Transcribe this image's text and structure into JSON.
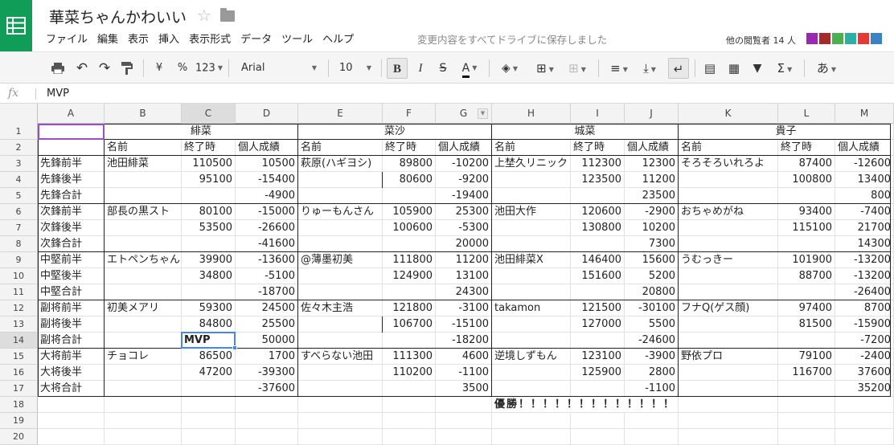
{
  "header": {
    "title": "華菜ちゃんかわいい",
    "menus": [
      "ファイル",
      "編集",
      "表示",
      "挿入",
      "表示形式",
      "データ",
      "ツール",
      "ヘルプ"
    ],
    "save_status": "変更内容をすべてドライブに保存しました",
    "viewers_label": "他の閲覧者 14 人",
    "viewer_colors": [
      "#9c27b0",
      "#a52a2a",
      "#4caf50",
      "#2db0a3",
      "#e53935",
      "#3b82c4"
    ]
  },
  "toolbar": {
    "currency": "¥",
    "percent": "%",
    "number_format": "123",
    "font": "Arial",
    "font_size": "10",
    "bold": "B",
    "italic": "I",
    "strike": "S",
    "text_color": "A",
    "input_tools": "あ",
    "sigma": "Σ"
  },
  "formula_bar": {
    "fx": "fx",
    "value": "MVP"
  },
  "grid": {
    "columns": [
      "A",
      "B",
      "C",
      "D",
      "E",
      "F",
      "G",
      "H",
      "I",
      "J",
      "K",
      "L",
      "M"
    ],
    "selected_column": "C",
    "filter_column": "G",
    "rows": [
      "1",
      "2",
      "3",
      "4",
      "5",
      "6",
      "7",
      "8",
      "9",
      "10",
      "11",
      "12",
      "13",
      "14",
      "15",
      "16",
      "17",
      "18",
      "19",
      "20"
    ],
    "selected_row": "14",
    "group_headers": [
      "緋菜",
      "菜沙",
      "城菜",
      "貴子"
    ],
    "subheaders": [
      "名前",
      "終了時",
      "個人成績"
    ],
    "data": [
      [
        "先鋒前半",
        "池田緋菜",
        "110500",
        "10500",
        "萩原(ハギヨシ)",
        "89800",
        "-10200",
        "上埜久リニック",
        "112300",
        "12300",
        "そろそろいれろよ",
        "87400",
        "-12600"
      ],
      [
        "先鋒後半",
        "",
        "95100",
        "-15400",
        "",
        "80600",
        "-9200",
        "",
        "123500",
        "11200",
        "",
        "100800",
        "13400"
      ],
      [
        "先鋒合計",
        "",
        "",
        "-4900",
        "",
        "",
        "-19400",
        "",
        "",
        "23500",
        "",
        "",
        "800"
      ],
      [
        "次鋒前半",
        "部長の黒スト",
        "80100",
        "-15000",
        "りゅーもんさん",
        "105900",
        "25300",
        "池田大作",
        "120600",
        "-2900",
        "おちゃめがね",
        "93400",
        "-7400"
      ],
      [
        "次鋒後半",
        "",
        "53500",
        "-26600",
        "",
        "100600",
        "-5300",
        "",
        "130800",
        "10200",
        "",
        "115100",
        "21700"
      ],
      [
        "次鋒合計",
        "",
        "",
        "-41600",
        "",
        "",
        "20000",
        "",
        "",
        "7300",
        "",
        "",
        "14300"
      ],
      [
        "中堅前半",
        "エトペンちゃん",
        "39900",
        "-13600",
        "@薄墨初美",
        "111800",
        "11200",
        "池田緋菜X",
        "146400",
        "15600",
        "うむっきー",
        "101900",
        "-13200"
      ],
      [
        "中堅後半",
        "",
        "34800",
        "-5100",
        "",
        "124900",
        "13100",
        "",
        "151600",
        "5200",
        "",
        "88700",
        "-13200"
      ],
      [
        "中堅合計",
        "",
        "",
        "-18700",
        "",
        "",
        "24300",
        "",
        "",
        "20800",
        "",
        "",
        "-26400"
      ],
      [
        "副将前半",
        "初美メアリ",
        "59300",
        "24500",
        "佐々木主浩",
        "121800",
        "-3100",
        "takamon",
        "121500",
        "-30100",
        "フナQ(ゲス顔)",
        "97400",
        "8700"
      ],
      [
        "副将後半",
        "",
        "84800",
        "25500",
        "",
        "106700",
        "-15100",
        "",
        "127000",
        "5500",
        "",
        "81500",
        "-15900"
      ],
      [
        "副将合計",
        "",
        "MVP",
        "50000",
        "",
        "",
        "-18200",
        "",
        "",
        "-24600",
        "",
        "",
        "-7200"
      ],
      [
        "大将前半",
        "チョコレ",
        "86500",
        "1700",
        "すべらない池田",
        "111300",
        "4600",
        "逆境しずもん",
        "123100",
        "-3900",
        "野依プロ",
        "79100",
        "-2400"
      ],
      [
        "大将後半",
        "",
        "47200",
        "-39300",
        "",
        "110200",
        "-1100",
        "",
        "125900",
        "2800",
        "",
        "116700",
        "37600"
      ],
      [
        "大将合計",
        "",
        "",
        "-37600",
        "",
        "",
        "3500",
        "",
        "",
        "-1100",
        "",
        "",
        "35200"
      ]
    ],
    "victory_text": "優勝！！！！！！！！！！！！！"
  }
}
